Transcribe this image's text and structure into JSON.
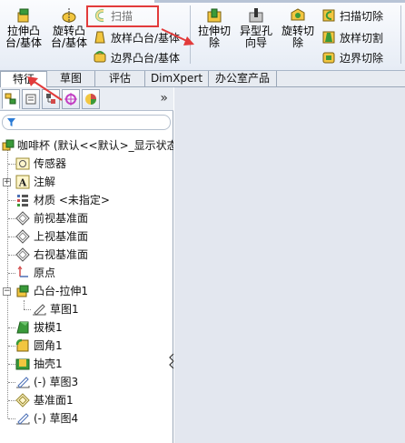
{
  "ribbon": {
    "extrude_boss": "拉伸凸\n台/基体",
    "revolve_boss": "旋转凸\n台/基体",
    "sweep": "扫描",
    "loft_boss": "放样凸台/基体",
    "boundary_boss": "边界凸台/基体",
    "extrude_cut": "拉伸切\n除",
    "hole_wizard": "异型孔\n向导",
    "revolve_cut": "旋转切\n除",
    "sweep_cut": "扫描切除",
    "loft_cut": "放样切割",
    "boundary_cut": "边界切除"
  },
  "tabs": [
    "特征",
    "草图",
    "评估",
    "DimXpert",
    "办公室产品"
  ],
  "panel": {
    "more": "»",
    "root": "咖啡杯 (默认<<默认>_显示状态",
    "items": [
      "传感器",
      "注解",
      "材质 <未指定>",
      "前视基准面",
      "上视基准面",
      "右视基准面",
      "原点",
      "凸台-拉伸1",
      "草图1",
      "拔模1",
      "圆角1",
      "抽壳1",
      "(-) 草图3",
      "基准面1",
      "(-) 草图4"
    ]
  },
  "colors": {
    "accent_red": "#e23b3b",
    "feature_green": "#3a9a3a",
    "plane_blue": "#4a6fb5"
  }
}
